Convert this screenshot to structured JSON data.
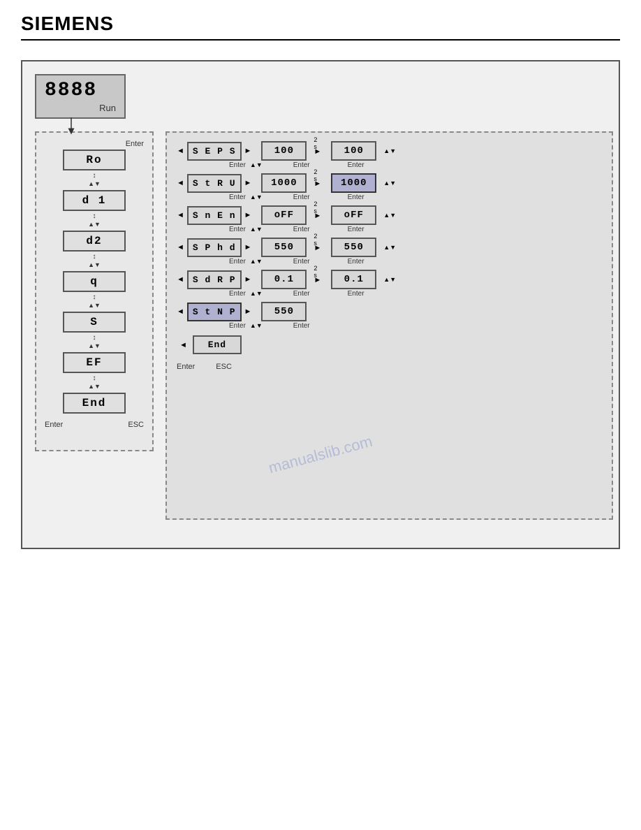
{
  "header": {
    "title": "SIEMENS"
  },
  "display": {
    "number": "8888",
    "run_label": "Run"
  },
  "left_panel": {
    "enter_label": "Enter",
    "esc_label": "ESC",
    "items": [
      {
        "label": "Ro",
        "selected": false
      },
      {
        "label": "d 1",
        "selected": false
      },
      {
        "label": "d2",
        "selected": false
      },
      {
        "label": "q",
        "selected": false
      },
      {
        "label": "S",
        "selected": false
      },
      {
        "label": "EF",
        "selected": false
      },
      {
        "label": "End",
        "selected": false
      }
    ]
  },
  "right_panel": {
    "enter_label": "Enter",
    "esc_label": "ESC",
    "rows": [
      {
        "param": "SEPS",
        "value": "100",
        "value2": "100",
        "enter1": "Enter",
        "enter2": "Enter",
        "enter3": "Enter",
        "two_s": "2 s",
        "av": "▲▼",
        "av2": "▲▼"
      },
      {
        "param": "StRU",
        "value": "1000",
        "value2": "1000",
        "enter1": "Enter",
        "enter2": "Enter",
        "enter3": "Enter",
        "two_s": "2 s",
        "av": "▲▼",
        "av2": "▲▼",
        "value2_selected": true
      },
      {
        "param": "SnEn",
        "value": "oFF",
        "value2": "oFF",
        "enter1": "Enter",
        "enter2": "Enter",
        "enter3": "Enter",
        "two_s": "2 s",
        "av": "▲▼",
        "av2": "▲▼"
      },
      {
        "param": "SPhd",
        "value": "550",
        "value2": "550",
        "enter1": "Enter",
        "enter2": "Enter",
        "enter3": "Enter",
        "two_s": "2 s",
        "av": "▲▼",
        "av2": "▲▼"
      },
      {
        "param": "SdRP",
        "value": "0.1",
        "value2": "0.1",
        "enter1": "Enter",
        "enter2": "Enter",
        "enter3": "Enter",
        "two_s": "2 s",
        "av": "▲▼",
        "av2": "▲▼"
      },
      {
        "param": "StNP",
        "value": "550",
        "value2": null,
        "enter1": "Enter",
        "enter2": "Enter",
        "enter3": null,
        "two_s": null,
        "av": "▲▼",
        "av2": null,
        "selected": true
      }
    ],
    "end_label": "End",
    "end_enter": "Enter"
  }
}
